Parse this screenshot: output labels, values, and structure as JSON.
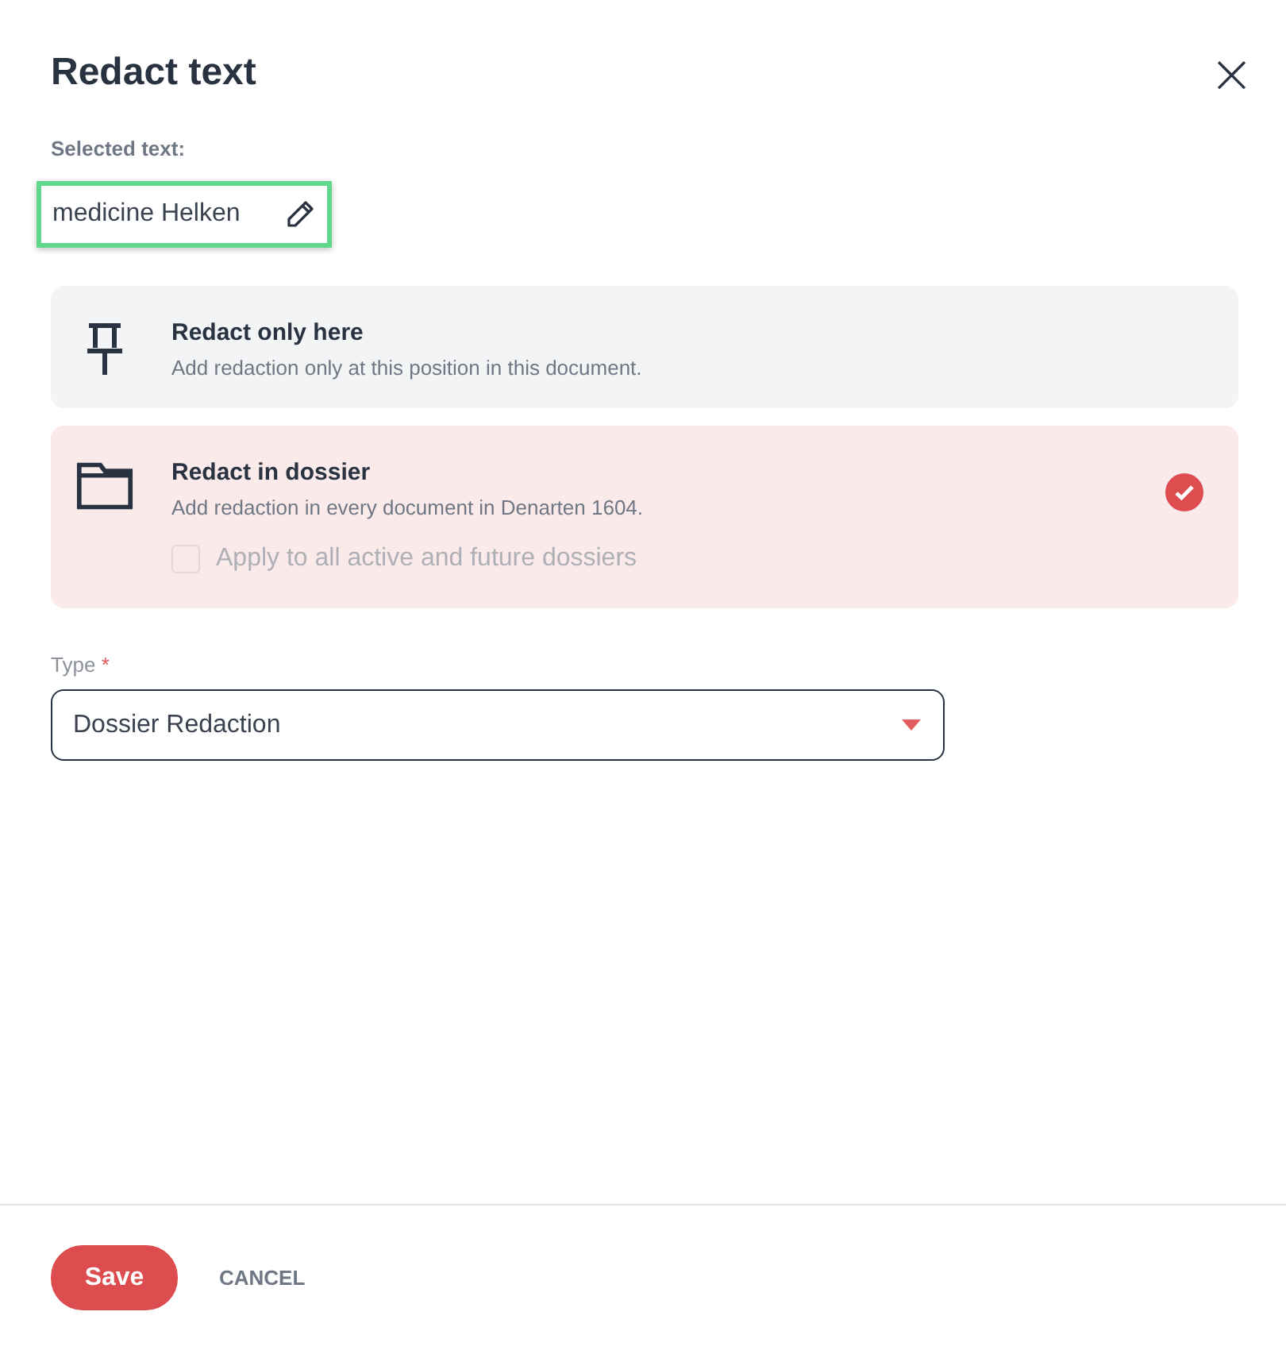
{
  "dialog": {
    "title": "Redact text",
    "close": "×"
  },
  "selected_text": {
    "label": "Selected text:",
    "value": "medicine Helken"
  },
  "options": [
    {
      "kind": "pin",
      "title": "Redact only here",
      "description": "Add redaction only at this position in this document.",
      "selected": false
    },
    {
      "kind": "folder",
      "title": "Redact in dossier",
      "description": "Add redaction in every document in Denarten 1604.",
      "selected": true,
      "checkbox": {
        "label": "Apply to all active and future dossiers",
        "checked": false,
        "disabled": true
      }
    }
  ],
  "type_field": {
    "label": "Type",
    "required_mark": "*",
    "value": "Dossier Redaction"
  },
  "buttons": [
    {
      "kind": "primary",
      "label": "Save"
    },
    {
      "kind": "text",
      "label": "CANCEL"
    }
  ]
}
